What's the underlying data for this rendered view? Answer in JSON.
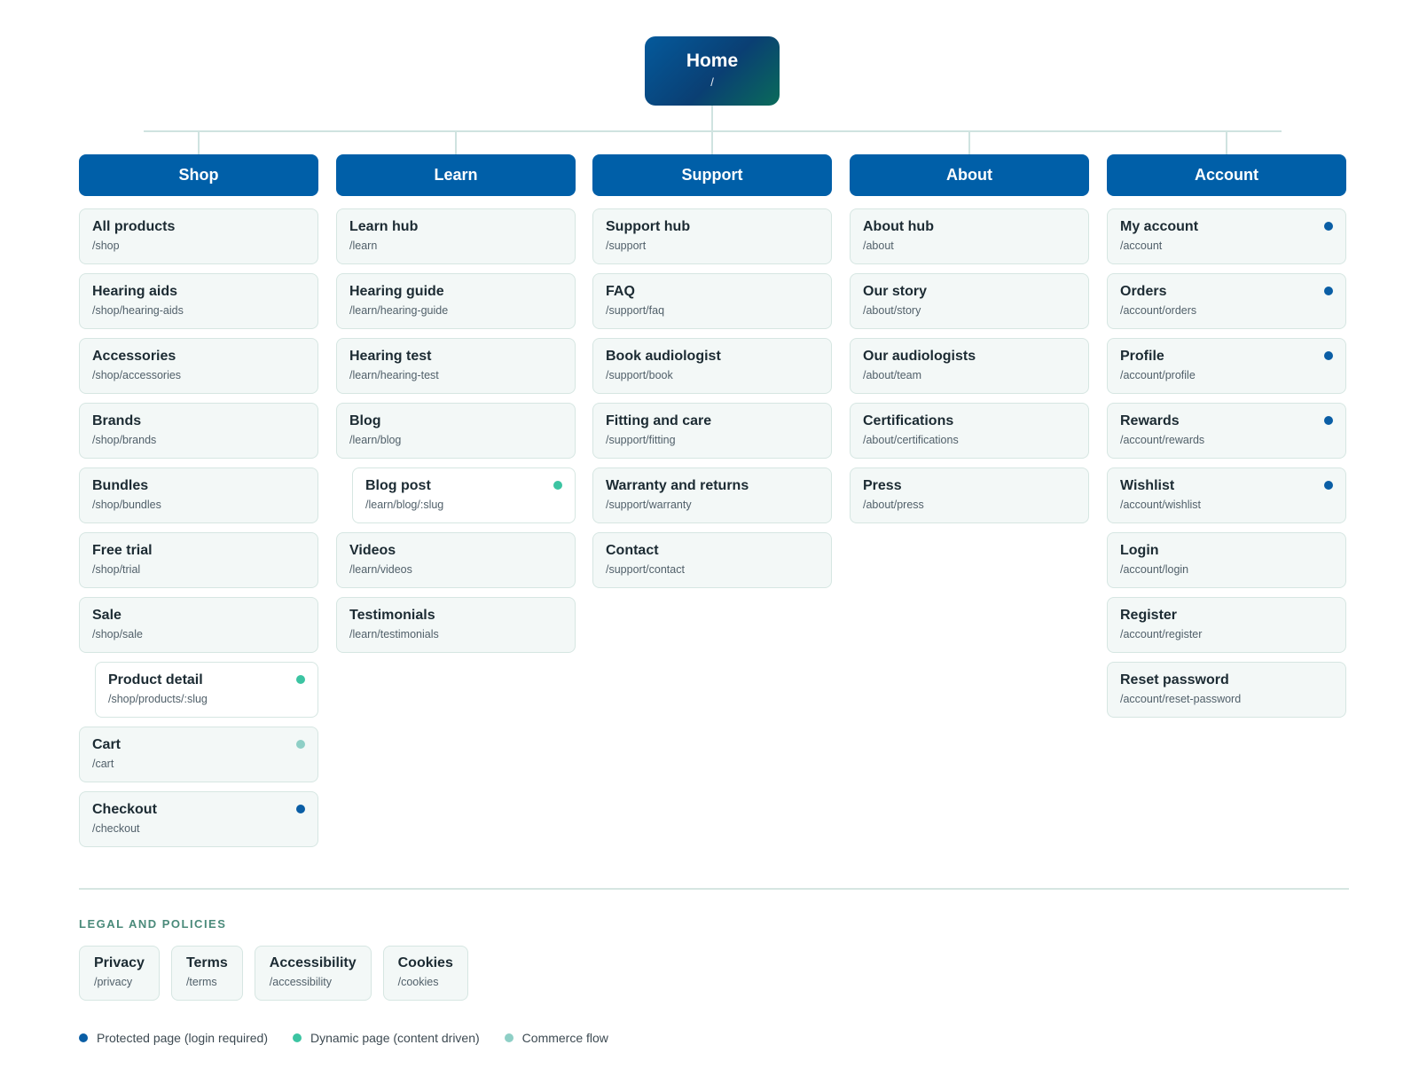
{
  "colors": {
    "protected": "#0a5ea5",
    "dynamic": "#3cc4a2",
    "commerce": "#8ecfc6"
  },
  "root": {
    "title": "Home",
    "path": "/"
  },
  "sections": [
    {
      "title": "Shop",
      "pages": [
        {
          "name": "All products",
          "path": "/shop",
          "marker": null,
          "child": false
        },
        {
          "name": "Hearing aids",
          "path": "/shop/hearing-aids",
          "marker": null,
          "child": false
        },
        {
          "name": "Accessories",
          "path": "/shop/accessories",
          "marker": null,
          "child": false
        },
        {
          "name": "Brands",
          "path": "/shop/brands",
          "marker": null,
          "child": false
        },
        {
          "name": "Bundles",
          "path": "/shop/bundles",
          "marker": null,
          "child": false
        },
        {
          "name": "Free trial",
          "path": "/shop/trial",
          "marker": null,
          "child": false
        },
        {
          "name": "Sale",
          "path": "/shop/sale",
          "marker": null,
          "child": false
        },
        {
          "name": "Product detail",
          "path": "/shop/products/:slug",
          "marker": "dynamic",
          "child": true
        },
        {
          "name": "Cart",
          "path": "/cart",
          "marker": "commerce",
          "child": false
        },
        {
          "name": "Checkout",
          "path": "/checkout",
          "marker": "protected",
          "child": false
        }
      ]
    },
    {
      "title": "Learn",
      "pages": [
        {
          "name": "Learn hub",
          "path": "/learn",
          "marker": null,
          "child": false
        },
        {
          "name": "Hearing guide",
          "path": "/learn/hearing-guide",
          "marker": null,
          "child": false
        },
        {
          "name": "Hearing test",
          "path": "/learn/hearing-test",
          "marker": null,
          "child": false
        },
        {
          "name": "Blog",
          "path": "/learn/blog",
          "marker": null,
          "child": false
        },
        {
          "name": "Blog post",
          "path": "/learn/blog/:slug",
          "marker": "dynamic",
          "child": true
        },
        {
          "name": "Videos",
          "path": "/learn/videos",
          "marker": null,
          "child": false
        },
        {
          "name": "Testimonials",
          "path": "/learn/testimonials",
          "marker": null,
          "child": false
        }
      ]
    },
    {
      "title": "Support",
      "pages": [
        {
          "name": "Support hub",
          "path": "/support",
          "marker": null,
          "child": false
        },
        {
          "name": "FAQ",
          "path": "/support/faq",
          "marker": null,
          "child": false
        },
        {
          "name": "Book audiologist",
          "path": "/support/book",
          "marker": null,
          "child": false
        },
        {
          "name": "Fitting and care",
          "path": "/support/fitting",
          "marker": null,
          "child": false
        },
        {
          "name": "Warranty and returns",
          "path": "/support/warranty",
          "marker": null,
          "child": false
        },
        {
          "name": "Contact",
          "path": "/support/contact",
          "marker": null,
          "child": false
        }
      ]
    },
    {
      "title": "About",
      "pages": [
        {
          "name": "About hub",
          "path": "/about",
          "marker": null,
          "child": false
        },
        {
          "name": "Our story",
          "path": "/about/story",
          "marker": null,
          "child": false
        },
        {
          "name": "Our audiologists",
          "path": "/about/team",
          "marker": null,
          "child": false
        },
        {
          "name": "Certifications",
          "path": "/about/certifications",
          "marker": null,
          "child": false
        },
        {
          "name": "Press",
          "path": "/about/press",
          "marker": null,
          "child": false
        }
      ]
    },
    {
      "title": "Account",
      "pages": [
        {
          "name": "My account",
          "path": "/account",
          "marker": "protected",
          "child": false
        },
        {
          "name": "Orders",
          "path": "/account/orders",
          "marker": "protected",
          "child": false
        },
        {
          "name": "Profile",
          "path": "/account/profile",
          "marker": "protected",
          "child": false
        },
        {
          "name": "Rewards",
          "path": "/account/rewards",
          "marker": "protected",
          "child": false
        },
        {
          "name": "Wishlist",
          "path": "/account/wishlist",
          "marker": "protected",
          "child": false
        },
        {
          "name": "Login",
          "path": "/account/login",
          "marker": null,
          "child": false
        },
        {
          "name": "Register",
          "path": "/account/register",
          "marker": null,
          "child": false
        },
        {
          "name": "Reset password",
          "path": "/account/reset-password",
          "marker": null,
          "child": false
        }
      ]
    }
  ],
  "legal": {
    "title": "LEGAL AND POLICIES",
    "pages": [
      {
        "name": "Privacy",
        "path": "/privacy"
      },
      {
        "name": "Terms",
        "path": "/terms"
      },
      {
        "name": "Accessibility",
        "path": "/accessibility"
      },
      {
        "name": "Cookies",
        "path": "/cookies"
      }
    ]
  },
  "legend": [
    {
      "marker": "protected",
      "label": "Protected page (login required)"
    },
    {
      "marker": "dynamic",
      "label": "Dynamic page (content driven)"
    },
    {
      "marker": "commerce",
      "label": "Commerce flow"
    }
  ]
}
